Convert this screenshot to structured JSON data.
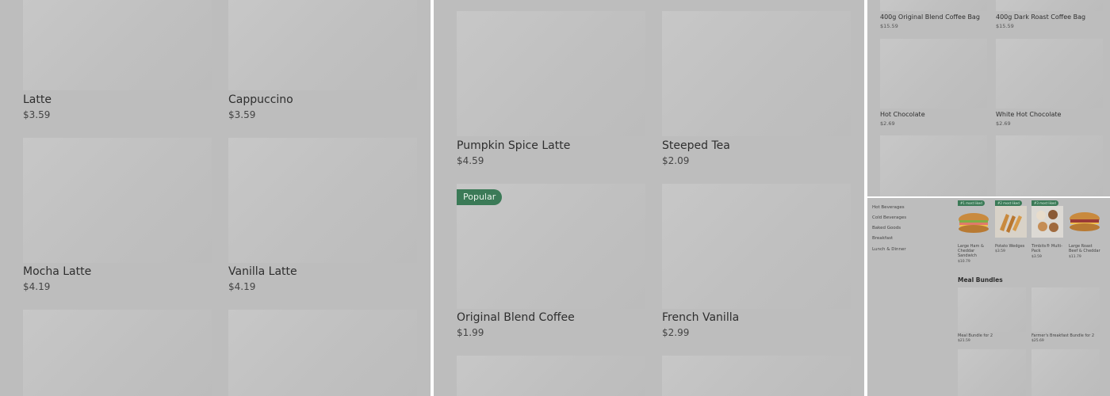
{
  "panel1": {
    "items": [
      {
        "name": "Latte",
        "price": "$3.59"
      },
      {
        "name": "Cappuccino",
        "price": "$3.59"
      },
      {
        "name": "Mocha Latte",
        "price": "$4.19"
      },
      {
        "name": "Vanilla Latte",
        "price": "$4.19"
      }
    ]
  },
  "panel2": {
    "items": [
      {
        "name": "Pumpkin Spice Latte",
        "price": "$4.59"
      },
      {
        "name": "Steeped Tea",
        "price": "$2.09"
      },
      {
        "name": "Original Blend Coffee",
        "price": "$1.99",
        "badge": "Popular"
      },
      {
        "name": "French Vanilla",
        "price": "$2.99"
      }
    ]
  },
  "panel3": {
    "items": [
      {
        "name": "400g Original Blend Coffee Bag",
        "price": "$15.59"
      },
      {
        "name": "400g Dark Roast Coffee Bag",
        "price": "$15.59"
      },
      {
        "name": "Hot Chocolate",
        "price": "$2.69"
      },
      {
        "name": "White Hot Chocolate",
        "price": "$2.69"
      }
    ]
  },
  "panel4": {
    "categories": [
      "Hot Beverages",
      "Cold Beverages",
      "Baked Goods",
      "Breakfast",
      "Lunch & Dinner"
    ],
    "featured": [
      {
        "name": "Large Ham & Cheddar Sandwich",
        "price": "$10.79",
        "badge": "#1 most liked",
        "icon": "sandwich-icon"
      },
      {
        "name": "Potato Wedges",
        "price": "$3.59",
        "badge": "#2 most liked",
        "icon": "wedges-icon"
      },
      {
        "name": "Timbits® Multi-Pack",
        "price": "$3.59",
        "badge": "#3 most liked",
        "icon": "timbits-icon"
      },
      {
        "name": "Large Roast Beef & Cheddar",
        "price": "$11.79",
        "icon": "roast-beef-icon"
      }
    ],
    "section_title": "Meal Bundles",
    "bundles": [
      {
        "name": "Meal Bundle for 2",
        "price": "$21.59"
      },
      {
        "name": "Farmer's Breakfast Bundle for 2",
        "price": "$25.69"
      }
    ]
  },
  "colors": {
    "overlay": "#bdbdbd",
    "badge": "#3b7a57",
    "divider": "#ffffff"
  }
}
